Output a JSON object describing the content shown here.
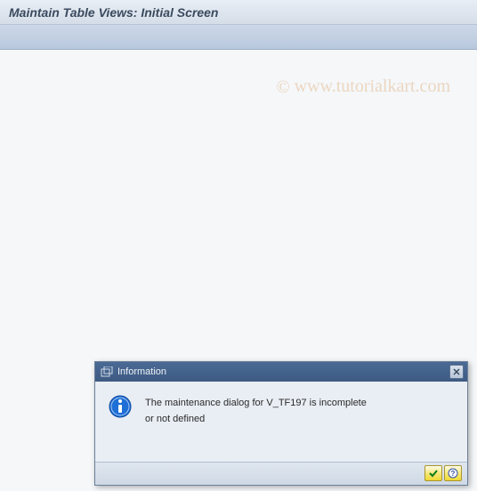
{
  "header": {
    "title": "Maintain Table Views: Initial Screen"
  },
  "watermark": {
    "symbol": "©",
    "text": "www.tutorialkart.com"
  },
  "dialog": {
    "title": "Information",
    "message_line1": "The maintenance dialog for V_TF197 is incomplete",
    "message_line2": "or not defined",
    "icons": {
      "title_icon": "overlap-window-icon",
      "body_icon": "info-icon",
      "close": "close-icon",
      "confirm": "check-icon",
      "help": "help-icon"
    },
    "colors": {
      "titlebar_bg": "#3d5a82",
      "info_circle": "#1e6fd6",
      "button_bg": "#f0d935"
    }
  }
}
